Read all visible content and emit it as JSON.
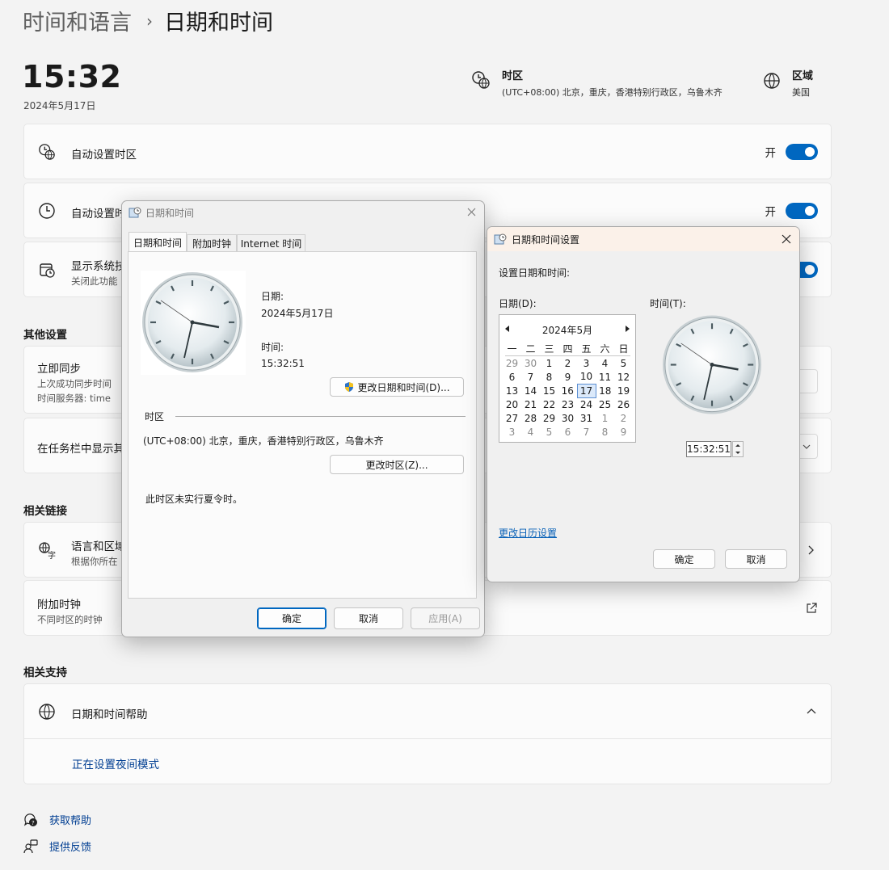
{
  "breadcrumb": {
    "parent": "时间和语言",
    "separator": "›",
    "current": "日期和时间"
  },
  "header": {
    "time": "15:32",
    "date": "2024年5月17日",
    "timezone": {
      "title": "时区",
      "value": "(UTC+08:00) 北京，重庆，香港特别行政区，乌鲁木齐"
    },
    "region": {
      "title": "区域",
      "value": "美国"
    }
  },
  "settings": {
    "auto_timezone": {
      "label": "自动设置时区",
      "state": "开"
    },
    "auto_time": {
      "label": "自动设置时",
      "state": "开"
    },
    "show_calendar": {
      "label": "显示系统技",
      "sub": "关闭此功能"
    }
  },
  "other": {
    "heading": "其他设置",
    "sync": {
      "label": "立即同步",
      "line1": "上次成功同步时间",
      "line2": "时间服务器: time"
    },
    "taskbar": {
      "label": "在任务栏中显示其"
    }
  },
  "related_links": {
    "heading": "相关链接",
    "lang": {
      "label": "语言和区域",
      "sub": "根据你所在"
    },
    "clocks": {
      "label": "附加时钟",
      "sub": "不同时区的时钟"
    }
  },
  "support": {
    "heading": "相关支持",
    "help": {
      "label": "日期和时间帮助",
      "link": "正在设置夜间模式"
    }
  },
  "footer": {
    "get_help": "获取帮助",
    "feedback": "提供反馈"
  },
  "dialog1": {
    "title": "日期和时间",
    "tabs": [
      "日期和时间",
      "附加时钟",
      "Internet 时间"
    ],
    "date_label": "日期:",
    "date_value": "2024年5月17日",
    "time_label": "时间:",
    "time_value": "15:32:51",
    "change_dt_button": "更改日期和时间(D)...",
    "tz_heading": "时区",
    "tz_value": "(UTC+08:00) 北京，重庆，香港特别行政区，乌鲁木齐",
    "change_tz_button": "更改时区(Z)...",
    "dst_note": "此时区未实行夏令时。",
    "ok": "确定",
    "cancel": "取消",
    "apply": "应用(A)"
  },
  "dialog2": {
    "title": "日期和时间设置",
    "instruction": "设置日期和时间:",
    "date_label": "日期(D):",
    "time_label": "时间(T):",
    "month": "2024年5月",
    "weekdays": [
      "一",
      "二",
      "三",
      "四",
      "五",
      "六",
      "日"
    ],
    "weeks": [
      [
        "29",
        "30",
        "1",
        "2",
        "3",
        "4",
        "5"
      ],
      [
        "6",
        "7",
        "8",
        "9",
        "10",
        "11",
        "12"
      ],
      [
        "13",
        "14",
        "15",
        "16",
        "17",
        "18",
        "19"
      ],
      [
        "20",
        "21",
        "22",
        "23",
        "24",
        "25",
        "26"
      ],
      [
        "27",
        "28",
        "29",
        "30",
        "31",
        "1",
        "2"
      ],
      [
        "3",
        "4",
        "5",
        "6",
        "7",
        "8",
        "9"
      ]
    ],
    "time_value": "15:32:51",
    "calendar_link": "更改日历设置",
    "ok": "确定",
    "cancel": "取消"
  }
}
